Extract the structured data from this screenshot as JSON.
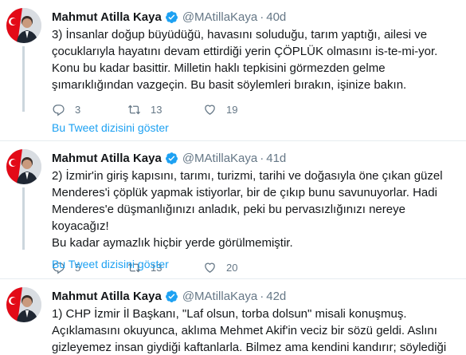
{
  "tweets": [
    {
      "name": "Mahmut Atilla Kaya",
      "handle": "@MAtillaKaya",
      "dot": "·",
      "time": "40d",
      "text": "3) İnsanlar doğup büyüdüğü, havasını soluduğu, tarım yaptığı, ailesi ve\nçocuklarıyla hayatını devam ettirdiği yerin ÇÖPLÜK olmasını is-te-mi-yor.\nKonu bu kadar basittir. Milletin haklı tepkisini görmezden gelme\nşımarıklığından vazgeçin. Bu basit söylemleri bırakın, işinize bakın.",
      "replies": "3",
      "retweets": "13",
      "likes": "19",
      "show_thread": "Bu Tweet dizisini göster"
    },
    {
      "name": "Mahmut Atilla Kaya",
      "handle": "@MAtillaKaya",
      "dot": "·",
      "time": "41d",
      "text": "2) İzmir'in giriş kapısını, tarımı, turizmi, tarihi ve doğasıyla öne çıkan güzel\nMenderes'i çöplük yapmak istiyorlar, bir de çıkıp bunu savunuyorlar. Hadi\nMenderes'e düşmanlığınızı anladık, peki bu pervasızlığınızı nereye koyacağız!\nBu kadar aymazlık hiçbir yerde görülmemiştir.",
      "replies": "5",
      "retweets": "13",
      "likes": "20",
      "show_thread": "Bu Tweet dizisini göster"
    },
    {
      "name": "Mahmut Atilla Kaya",
      "handle": "@MAtillaKaya",
      "dot": "·",
      "time": "42d",
      "text": "1) CHP İzmir İl Başkanı, \"Laf olsun, torba dolsun\" misali konuşmuş.\nAçıklamasını okuyunca, aklıma Mehmet Akif'in veciz bir sözü geldi. Aslını\ngizleyemez insan giydiği kaftanlarla. Bilmez ama kendini kandırır; söylediği"
    }
  ],
  "colors": {
    "link": "#1da1f2",
    "muted": "#657786",
    "verified": "#1da1f2",
    "divider": "#e6ecf0"
  },
  "icons": [
    "verified-badge-icon",
    "reply-icon",
    "retweet-icon",
    "like-icon"
  ]
}
